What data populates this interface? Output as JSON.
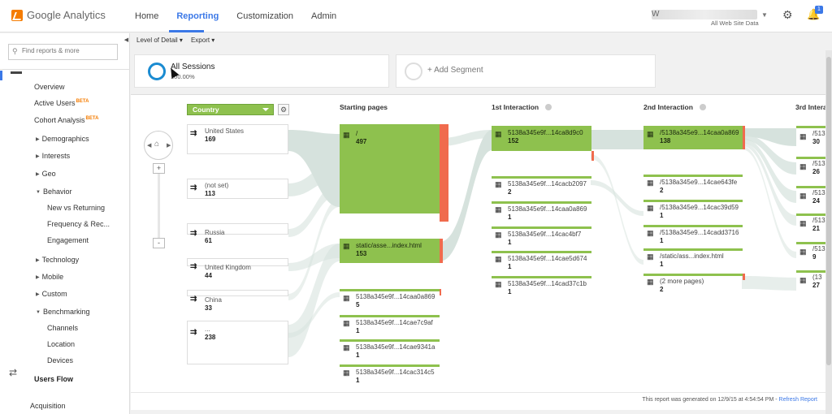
{
  "app": {
    "name": "Google Analytics"
  },
  "topnav": {
    "items": [
      "Home",
      "Reporting",
      "Customization",
      "Admin"
    ],
    "active": "Reporting"
  },
  "account": {
    "initial": "W",
    "property": "All Web Site Data",
    "notifications": "1"
  },
  "sidebar": {
    "search_placeholder": "Find reports & more",
    "items": [
      {
        "label": "Overview",
        "beta": ""
      },
      {
        "label": "Active Users",
        "beta": "BETA"
      },
      {
        "label": "Cohort Analysis",
        "beta": "BETA"
      },
      {
        "label": "Demographics"
      },
      {
        "label": "Interests"
      },
      {
        "label": "Geo"
      },
      {
        "label": "Behavior"
      },
      {
        "label": "New vs Returning"
      },
      {
        "label": "Frequency & Rec..."
      },
      {
        "label": "Engagement"
      },
      {
        "label": "Technology"
      },
      {
        "label": "Mobile"
      },
      {
        "label": "Custom"
      },
      {
        "label": "Benchmarking"
      },
      {
        "label": "Channels"
      },
      {
        "label": "Location"
      },
      {
        "label": "Devices"
      },
      {
        "label": "Users Flow"
      },
      {
        "label": "Acquisition"
      }
    ]
  },
  "toolbar": {
    "level_of_detail": "Level of Detail",
    "export": "Export"
  },
  "segments": {
    "active_name": "All Sessions",
    "active_pct": "100.00%",
    "add_label": "+ Add Segment"
  },
  "flow": {
    "dimension": "Country",
    "columns": [
      "Starting pages",
      "1st Interaction",
      "2nd Interaction",
      "3rd Intera"
    ],
    "countries": [
      {
        "name": "United States",
        "value": "169"
      },
      {
        "name": "(not set)",
        "value": "113"
      },
      {
        "name": "Russia",
        "value": "61"
      },
      {
        "name": "United Kingdom",
        "value": "44"
      },
      {
        "name": "China",
        "value": "33"
      },
      {
        "name": "...",
        "value": "238"
      }
    ],
    "starting_pages": [
      {
        "name": "/",
        "value": "497"
      },
      {
        "name": "static/asse...index.html",
        "value": "153"
      },
      {
        "name": "5138a345e9f...14caa0a869",
        "value": "5"
      },
      {
        "name": "5138a345e9f...14cae7c9af",
        "value": "1"
      },
      {
        "name": "5138a345e9f...14cae9341a",
        "value": "1"
      },
      {
        "name": "5138a345e9f...14cac314c5",
        "value": "1"
      }
    ],
    "first_interaction": [
      {
        "name": "5138a345e9f...14ca8d9c0",
        "value": "152"
      },
      {
        "name": "5138a345e9f...14cacb2097",
        "value": "2"
      },
      {
        "name": "5138a345e9f...14caa0a869",
        "value": "1"
      },
      {
        "name": "5138a345e9f...14cac4bf7",
        "value": "1"
      },
      {
        "name": "5138a345e9f...14cae5d674",
        "value": "1"
      },
      {
        "name": "5138a345e9f...14cad37c1b",
        "value": "1"
      }
    ],
    "second_interaction": [
      {
        "name": "/5138a345e9...14caa0a869",
        "value": "138"
      },
      {
        "name": "/5138a345e9...14cae643fe",
        "value": "2"
      },
      {
        "name": "/5138a345e9...14cac39d59",
        "value": "1"
      },
      {
        "name": "/5138a345e9...14cadd3716",
        "value": "1"
      },
      {
        "name": "/static/ass...index.html",
        "value": "1"
      },
      {
        "name": "(2 more pages)",
        "value": "2"
      }
    ],
    "third_interaction": [
      {
        "name": "/513",
        "value": "30"
      },
      {
        "name": "/513",
        "value": "26"
      },
      {
        "name": "/513",
        "value": "24"
      },
      {
        "name": "/513",
        "value": "21"
      },
      {
        "name": "/513",
        "value": "9"
      },
      {
        "name": "(13",
        "value": "27"
      }
    ]
  },
  "footer": {
    "generated": "This report was generated on 12/9/15 at 4:54:54 PM -",
    "refresh": "Refresh Report"
  }
}
